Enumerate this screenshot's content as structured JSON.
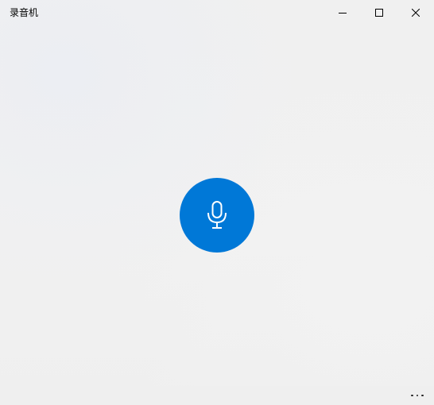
{
  "window": {
    "title": "录音机"
  },
  "titlebar": {
    "minimize_icon": "minimize-icon",
    "maximize_icon": "maximize-icon",
    "close_icon": "close-icon"
  },
  "main": {
    "record_icon": "microphone-icon"
  },
  "bottom_bar": {
    "more_icon": "more-options-icon"
  },
  "colors": {
    "accent": "#0078d7",
    "background": "#f0f0f0",
    "text": "#000000",
    "icon_on_accent": "#ffffff"
  }
}
